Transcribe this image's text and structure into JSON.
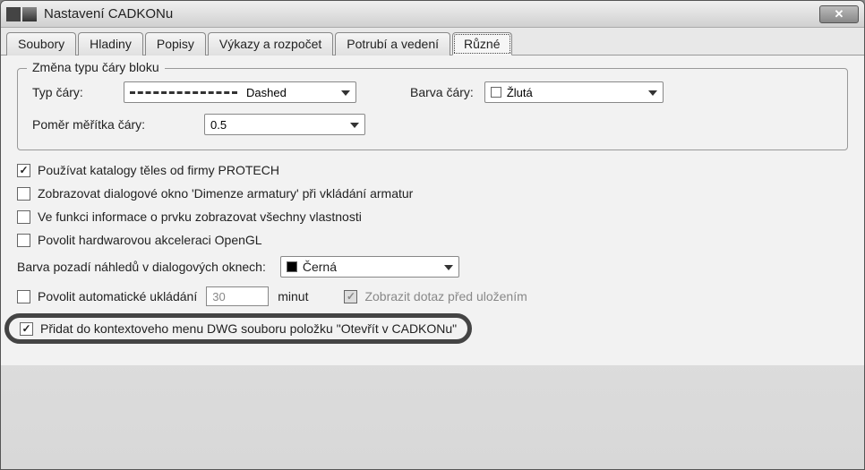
{
  "window": {
    "title": "Nastavení CADKONu"
  },
  "tabs": {
    "t0": "Soubory",
    "t1": "Hladiny",
    "t2": "Popisy",
    "t3": "Výkazy a rozpočet",
    "t4": "Potrubí a vedení",
    "t5": "Různé"
  },
  "group": {
    "title": "Změna typu čáry bloku",
    "linetype_label": "Typ čáry:",
    "linetype_value": "Dashed",
    "color_label": "Barva čáry:",
    "color_value": "Žlutá",
    "scale_label": "Poměr měřítka čáry:",
    "scale_value": "0.5"
  },
  "checks": {
    "c1": "Používat katalogy těles od firmy PROTECH",
    "c2": "Zobrazovat dialogové okno 'Dimenze armatury' při vkládání armatur",
    "c3": "Ve funkci informace o prvku zobrazovat všechny vlastnosti",
    "c4": "Povolit hardwarovou akceleraci OpenGL",
    "bg_label": "Barva pozadí náhledů v dialogových oknech:",
    "bg_value": "Černá",
    "c5": "Povolit automatické ukládání",
    "interval": "30",
    "minutes": "minut",
    "c6": "Zobrazit dotaz před uložením",
    "c7": "Přidat do kontextoveho menu DWG souboru položku \"Otevřít v CADKONu\""
  }
}
